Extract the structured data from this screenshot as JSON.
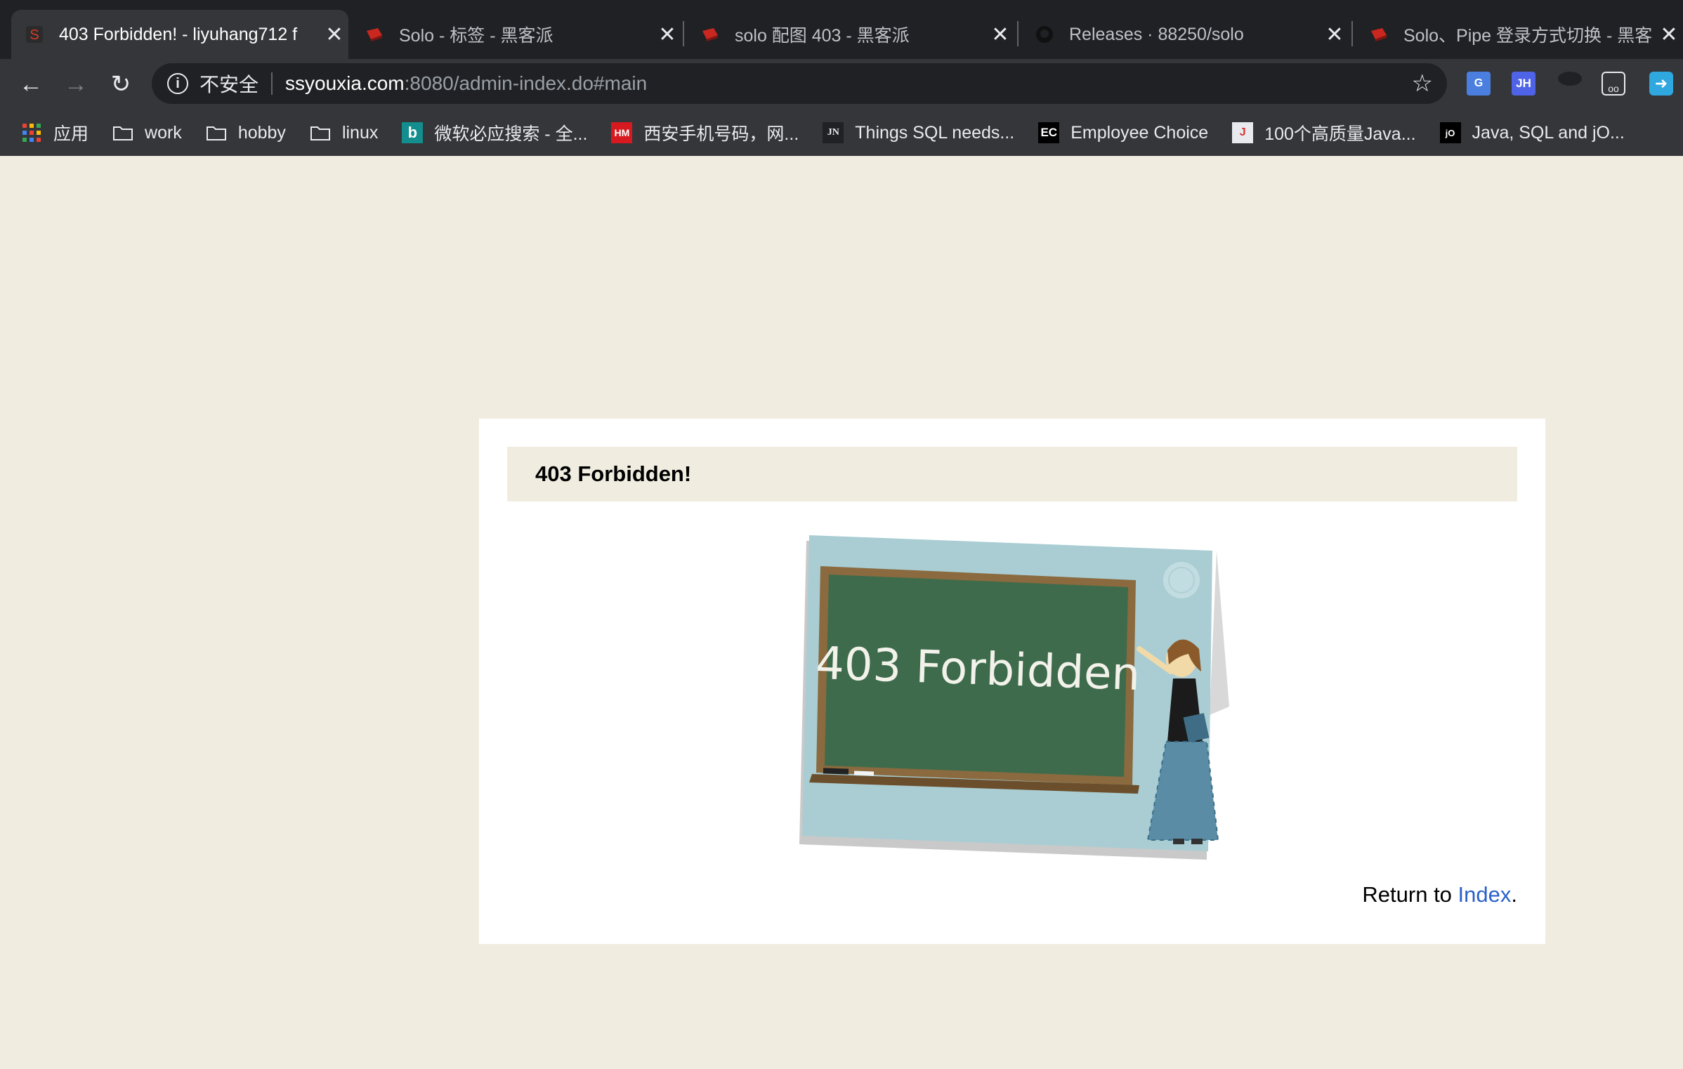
{
  "browser": {
    "tabs": [
      {
        "title": "403 Forbidden! - liyuhang712 f",
        "active": true,
        "favicon": "solo-s-icon"
      },
      {
        "title": "Solo - 标签 - 黑客派",
        "active": false,
        "favicon": "hacpai-icon"
      },
      {
        "title": "solo 配图 403 - 黑客派",
        "active": false,
        "favicon": "hacpai-icon"
      },
      {
        "title": "Releases · 88250/solo",
        "active": false,
        "favicon": "github-icon"
      },
      {
        "title": "Solo、Pipe 登录方式切换 - 黑客",
        "active": false,
        "favicon": "hacpai-icon"
      }
    ],
    "address": {
      "security_label": "不安全",
      "host": "ssyouxia.com",
      "rest": ":8080/admin-index.do#main"
    },
    "bookmarks": [
      {
        "label": "应用",
        "icon": "apps-grid-icon"
      },
      {
        "label": "work",
        "icon": "folder-icon"
      },
      {
        "label": "hobby",
        "icon": "folder-icon"
      },
      {
        "label": "linux",
        "icon": "folder-icon"
      },
      {
        "label": "微软必应搜索 - 全...",
        "icon": "bing-icon",
        "badge": "b"
      },
      {
        "label": "西安手机号码，网...",
        "icon": "hm-icon",
        "badge": "HM"
      },
      {
        "label": "Things SQL needs...",
        "icon": "jn-icon",
        "badge": "JN"
      },
      {
        "label": "Employee Choice",
        "icon": "ec-icon",
        "badge": "EC"
      },
      {
        "label": "100个高质量Java...",
        "icon": "java-icon",
        "badge": "J"
      },
      {
        "label": "Java, SQL and jO...",
        "icon": "jooq-icon",
        "badge": "jO"
      }
    ],
    "extensions": [
      "google-translate-icon",
      "jh-icon",
      "ninja-icon",
      "spectacles-icon",
      "share-arrow-icon"
    ]
  },
  "page": {
    "header_title": "403 Forbidden!",
    "illustration_text": "403 Forbidden",
    "return_prefix": "Return to ",
    "return_link": "Index",
    "return_suffix": "."
  },
  "colors": {
    "page_bg": "#f0ede0",
    "card_bg": "#ffffff",
    "link": "#2a62c9"
  }
}
